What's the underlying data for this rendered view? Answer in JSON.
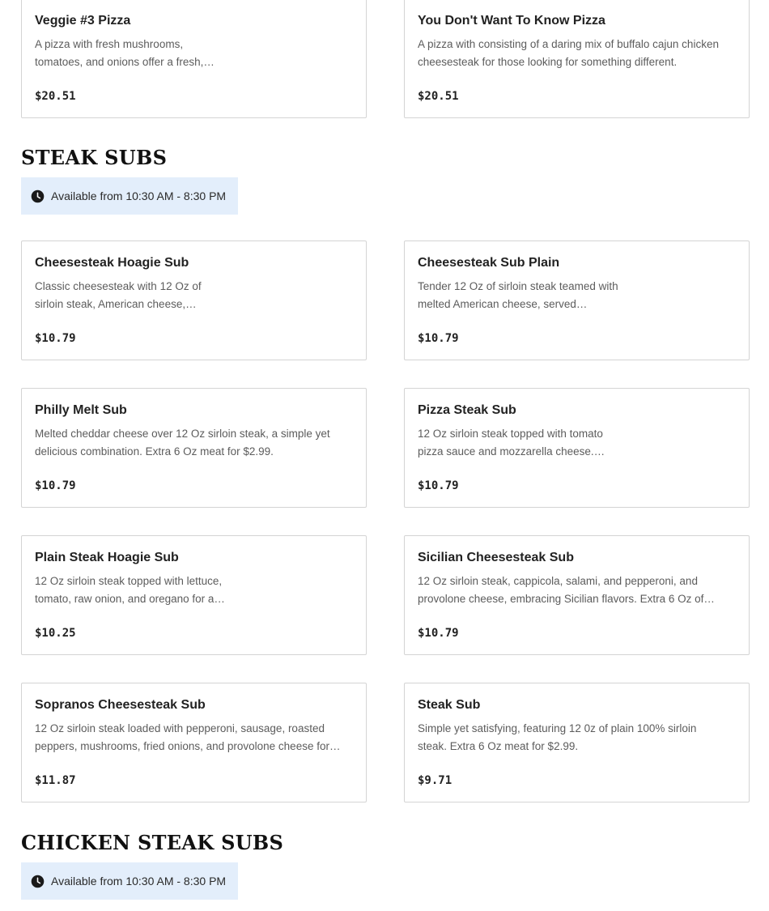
{
  "top_items": [
    {
      "name": "Veggie #3 Pizza",
      "desc": "A pizza with fresh mushrooms, tomatoes, and onions offer a fresh,…",
      "price": "$20.51"
    },
    {
      "name": "You Don't Want To Know Pizza",
      "desc": "A pizza with consisting of a daring mix of buffalo cajun chicken cheesesteak for those looking for something different.",
      "price": "$20.51"
    }
  ],
  "steak_subs": {
    "title": "STEAK SUBS",
    "availability": "Available from 10:30 AM - 8:30 PM",
    "items": [
      {
        "name": "Cheesesteak Hoagie Sub",
        "desc": "Classic cheesesteak with 12 Oz of sirloin steak, American cheese,…",
        "price": "$10.79"
      },
      {
        "name": "Cheesesteak Sub Plain",
        "desc": "Tender 12 Oz of sirloin steak teamed with melted American cheese, served…",
        "price": "$10.79"
      },
      {
        "name": "Philly Melt Sub",
        "desc": "Melted cheddar cheese over 12 Oz sirloin steak, a simple yet delicious combination. Extra 6 Oz meat for $2.99.",
        "price": "$10.79"
      },
      {
        "name": "Pizza Steak Sub",
        "desc": "12 Oz sirloin steak topped with tomato pizza sauce and mozzarella cheese.…",
        "price": "$10.79"
      },
      {
        "name": "Plain Steak Hoagie Sub",
        "desc": "12 Oz sirloin steak topped with lettuce, tomato, raw onion, and oregano for a…",
        "price": "$10.25"
      },
      {
        "name": "Sicilian Cheesesteak Sub",
        "desc": "12 Oz sirloin steak, cappicola, salami, and pepperoni, and provolone cheese, embracing Sicilian flavors. Extra 6 Oz of…",
        "price": "$10.79"
      },
      {
        "name": "Sopranos Cheesesteak Sub",
        "desc": "12 Oz sirloin steak loaded with pepperoni, sausage, roasted peppers, mushrooms, fried onions, and provolone cheese for…",
        "price": "$11.87"
      },
      {
        "name": "Steak Sub",
        "desc": "Simple yet satisfying, featuring 12 0z of plain 100% sirloin steak. Extra 6 Oz meat for $2.99.",
        "price": "$9.71"
      }
    ]
  },
  "chicken_steak_subs": {
    "title": "CHICKEN STEAK SUBS",
    "availability": "Available from 10:30 AM - 8:30 PM"
  },
  "colors": {
    "availability_bg": "#e3eefb",
    "card_border": "#d4d4d4"
  },
  "icons": {
    "availability": "clock-icon"
  }
}
